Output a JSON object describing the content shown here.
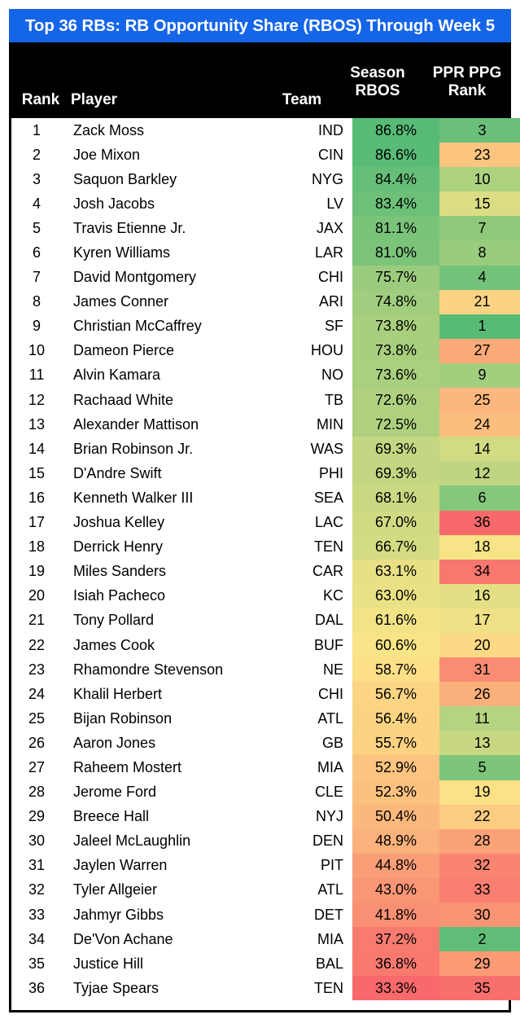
{
  "title": "Top 36 RBs: RB Opportunity Share (RBOS) Through Week 5",
  "colors": {
    "title_bar": "#1565E8",
    "header_bg": "#000000",
    "header_text": "#FFFFFF",
    "scale_high": "#57BB76",
    "scale_mid": "#FAE584",
    "scale_low": "#F8696B"
  },
  "header": {
    "rank": "Rank",
    "player": "Player",
    "team": "Team",
    "rbos_line1": "Season",
    "rbos_line2": "RBOS",
    "ppg_line1": "PPR PPG",
    "ppg_line2": "Rank"
  },
  "chart_data": {
    "type": "table",
    "title": "Top 36 RBs: RB Opportunity Share (RBOS) Through Week 5",
    "columns": [
      "Rank",
      "Player",
      "Team",
      "Season RBOS",
      "PPR PPG Rank"
    ],
    "rows": [
      {
        "rank": "1",
        "player": "Zack Moss",
        "team": "IND",
        "rbos": "86.8%",
        "rbos_val": 86.8,
        "ppg": "3",
        "ppg_val": 3
      },
      {
        "rank": "2",
        "player": "Joe Mixon",
        "team": "CIN",
        "rbos": "86.6%",
        "rbos_val": 86.6,
        "ppg": "23",
        "ppg_val": 23
      },
      {
        "rank": "3",
        "player": "Saquon Barkley",
        "team": "NYG",
        "rbos": "84.4%",
        "rbos_val": 84.4,
        "ppg": "10",
        "ppg_val": 10
      },
      {
        "rank": "4",
        "player": "Josh Jacobs",
        "team": "LV",
        "rbos": "83.4%",
        "rbos_val": 83.4,
        "ppg": "15",
        "ppg_val": 15
      },
      {
        "rank": "5",
        "player": "Travis Etienne Jr.",
        "team": "JAX",
        "rbos": "81.1%",
        "rbos_val": 81.1,
        "ppg": "7",
        "ppg_val": 7
      },
      {
        "rank": "6",
        "player": "Kyren Williams",
        "team": "LAR",
        "rbos": "81.0%",
        "rbos_val": 81.0,
        "ppg": "8",
        "ppg_val": 8
      },
      {
        "rank": "7",
        "player": "David Montgomery",
        "team": "CHI",
        "rbos": "75.7%",
        "rbos_val": 75.7,
        "ppg": "4",
        "ppg_val": 4
      },
      {
        "rank": "8",
        "player": "James Conner",
        "team": "ARI",
        "rbos": "74.8%",
        "rbos_val": 74.8,
        "ppg": "21",
        "ppg_val": 21
      },
      {
        "rank": "9",
        "player": "Christian McCaffrey",
        "team": "SF",
        "rbos": "73.8%",
        "rbos_val": 73.8,
        "ppg": "1",
        "ppg_val": 1
      },
      {
        "rank": "10",
        "player": "Dameon Pierce",
        "team": "HOU",
        "rbos": "73.8%",
        "rbos_val": 73.8,
        "ppg": "27",
        "ppg_val": 27
      },
      {
        "rank": "11",
        "player": "Alvin Kamara",
        "team": "NO",
        "rbos": "73.6%",
        "rbos_val": 73.6,
        "ppg": "9",
        "ppg_val": 9
      },
      {
        "rank": "12",
        "player": "Rachaad White",
        "team": "TB",
        "rbos": "72.6%",
        "rbos_val": 72.6,
        "ppg": "25",
        "ppg_val": 25
      },
      {
        "rank": "13",
        "player": "Alexander Mattison",
        "team": "MIN",
        "rbos": "72.5%",
        "rbos_val": 72.5,
        "ppg": "24",
        "ppg_val": 24
      },
      {
        "rank": "14",
        "player": "Brian Robinson Jr.",
        "team": "WAS",
        "rbos": "69.3%",
        "rbos_val": 69.3,
        "ppg": "14",
        "ppg_val": 14
      },
      {
        "rank": "15",
        "player": "D'Andre Swift",
        "team": "PHI",
        "rbos": "69.3%",
        "rbos_val": 69.3,
        "ppg": "12",
        "ppg_val": 12
      },
      {
        "rank": "16",
        "player": "Kenneth Walker III",
        "team": "SEA",
        "rbos": "68.1%",
        "rbos_val": 68.1,
        "ppg": "6",
        "ppg_val": 6
      },
      {
        "rank": "17",
        "player": "Joshua Kelley",
        "team": "LAC",
        "rbos": "67.0%",
        "rbos_val": 67.0,
        "ppg": "36",
        "ppg_val": 36
      },
      {
        "rank": "18",
        "player": "Derrick Henry",
        "team": "TEN",
        "rbos": "66.7%",
        "rbos_val": 66.7,
        "ppg": "18",
        "ppg_val": 18
      },
      {
        "rank": "19",
        "player": "Miles Sanders",
        "team": "CAR",
        "rbos": "63.1%",
        "rbos_val": 63.1,
        "ppg": "34",
        "ppg_val": 34
      },
      {
        "rank": "20",
        "player": "Isiah Pacheco",
        "team": "KC",
        "rbos": "63.0%",
        "rbos_val": 63.0,
        "ppg": "16",
        "ppg_val": 16
      },
      {
        "rank": "21",
        "player": "Tony Pollard",
        "team": "DAL",
        "rbos": "61.6%",
        "rbos_val": 61.6,
        "ppg": "17",
        "ppg_val": 17
      },
      {
        "rank": "22",
        "player": "James Cook",
        "team": "BUF",
        "rbos": "60.6%",
        "rbos_val": 60.6,
        "ppg": "20",
        "ppg_val": 20
      },
      {
        "rank": "23",
        "player": "Rhamondre Stevenson",
        "team": "NE",
        "rbos": "58.7%",
        "rbos_val": 58.7,
        "ppg": "31",
        "ppg_val": 31
      },
      {
        "rank": "24",
        "player": "Khalil Herbert",
        "team": "CHI",
        "rbos": "56.7%",
        "rbos_val": 56.7,
        "ppg": "26",
        "ppg_val": 26
      },
      {
        "rank": "25",
        "player": "Bijan Robinson",
        "team": "ATL",
        "rbos": "56.4%",
        "rbos_val": 56.4,
        "ppg": "11",
        "ppg_val": 11
      },
      {
        "rank": "26",
        "player": "Aaron Jones",
        "team": "GB",
        "rbos": "55.7%",
        "rbos_val": 55.7,
        "ppg": "13",
        "ppg_val": 13
      },
      {
        "rank": "27",
        "player": "Raheem Mostert",
        "team": "MIA",
        "rbos": "52.9%",
        "rbos_val": 52.9,
        "ppg": "5",
        "ppg_val": 5
      },
      {
        "rank": "28",
        "player": "Jerome Ford",
        "team": "CLE",
        "rbos": "52.3%",
        "rbos_val": 52.3,
        "ppg": "19",
        "ppg_val": 19
      },
      {
        "rank": "29",
        "player": "Breece Hall",
        "team": "NYJ",
        "rbos": "50.4%",
        "rbos_val": 50.4,
        "ppg": "22",
        "ppg_val": 22
      },
      {
        "rank": "30",
        "player": "Jaleel McLaughlin",
        "team": "DEN",
        "rbos": "48.9%",
        "rbos_val": 48.9,
        "ppg": "28",
        "ppg_val": 28
      },
      {
        "rank": "31",
        "player": "Jaylen Warren",
        "team": "PIT",
        "rbos": "44.8%",
        "rbos_val": 44.8,
        "ppg": "32",
        "ppg_val": 32
      },
      {
        "rank": "32",
        "player": "Tyler Allgeier",
        "team": "ATL",
        "rbos": "43.0%",
        "rbos_val": 43.0,
        "ppg": "33",
        "ppg_val": 33
      },
      {
        "rank": "33",
        "player": "Jahmyr Gibbs",
        "team": "DET",
        "rbos": "41.8%",
        "rbos_val": 41.8,
        "ppg": "30",
        "ppg_val": 30
      },
      {
        "rank": "34",
        "player": "De'Von Achane",
        "team": "MIA",
        "rbos": "37.2%",
        "rbos_val": 37.2,
        "ppg": "2",
        "ppg_val": 2
      },
      {
        "rank": "35",
        "player": "Justice Hill",
        "team": "BAL",
        "rbos": "36.8%",
        "rbos_val": 36.8,
        "ppg": "29",
        "ppg_val": 29
      },
      {
        "rank": "36",
        "player": "Tyjae Spears",
        "team": "TEN",
        "rbos": "33.3%",
        "rbos_val": 33.3,
        "ppg": "35",
        "ppg_val": 35
      }
    ],
    "rbos_range": [
      33.3,
      86.8
    ],
    "ppg_range": [
      1,
      36
    ]
  }
}
